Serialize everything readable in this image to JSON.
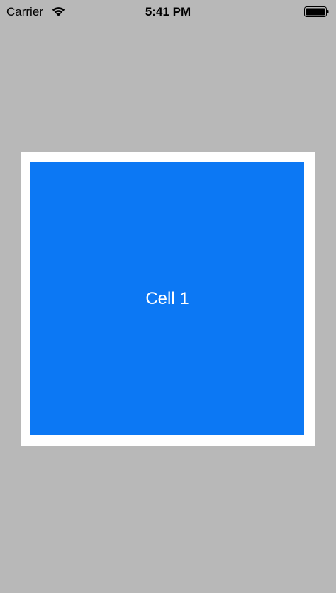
{
  "status_bar": {
    "carrier": "Carrier",
    "time": "5:41 PM",
    "wifi_icon": "wifi-icon",
    "battery_icon": "battery-full-icon"
  },
  "collection": {
    "cells": [
      {
        "label": "Cell 1",
        "color": "#0c78f4"
      }
    ]
  },
  "colors": {
    "background": "#b8b8b8",
    "cell_border": "#ffffff",
    "cell_fill": "#0c78f4",
    "cell_text": "#ffffff"
  }
}
